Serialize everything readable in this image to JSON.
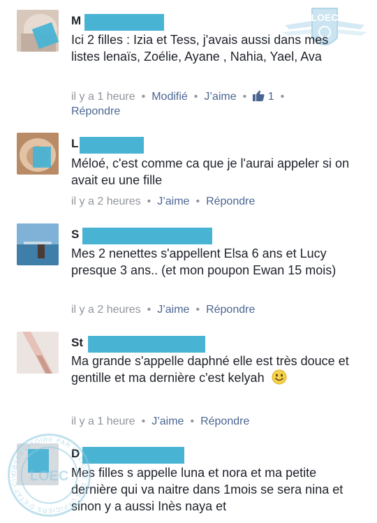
{
  "watermark": {
    "brand": "LOEC",
    "ring_text": "OBSERVATOIRE PAR LA LIGUE DES OFFICIERS D'ETAT CIVIL"
  },
  "colors": {
    "link": "#4b6593",
    "meta": "#90949c",
    "redact": "#49b3d4"
  },
  "comments": [
    {
      "initial": "M",
      "text": "Ici 2 filles : Izia et Tess, j'avais aussi dans mes listes lenaïs, Zoélie, Ayane , Nahia, Yael, Ava",
      "time": "il y a 1 heure",
      "edited": "Modifié",
      "like": "J’aime",
      "like_count": "1",
      "reply": "Répondre"
    },
    {
      "initial": "L",
      "text": "Méloé, c'est comme ca que je l'aurai appeler si on avait eu une fille",
      "time": "il y a 2 heures",
      "like": "J’aime",
      "reply": "Répondre"
    },
    {
      "initial": "S",
      "text": "Mes 2 nenettes s'appellent Elsa 6 ans et Lucy presque 3 ans.. (et mon poupon Ewan 15 mois)",
      "time": "il y a 2 heures",
      "like": "J’aime",
      "reply": "Répondre"
    },
    {
      "initial": "St",
      "text": "Ma grande s'appelle daphné elle est très douce et gentille et ma dernière c'est kelyah",
      "time": "il y a 1 heure",
      "like": "J’aime",
      "reply": "Répondre"
    },
    {
      "initial": "D",
      "text": "Mes filles s appelle luna et nora et ma petite dernière qui va naitre dans 1mois se sera nina et sinon y a aussi Inès naya et"
    }
  ]
}
